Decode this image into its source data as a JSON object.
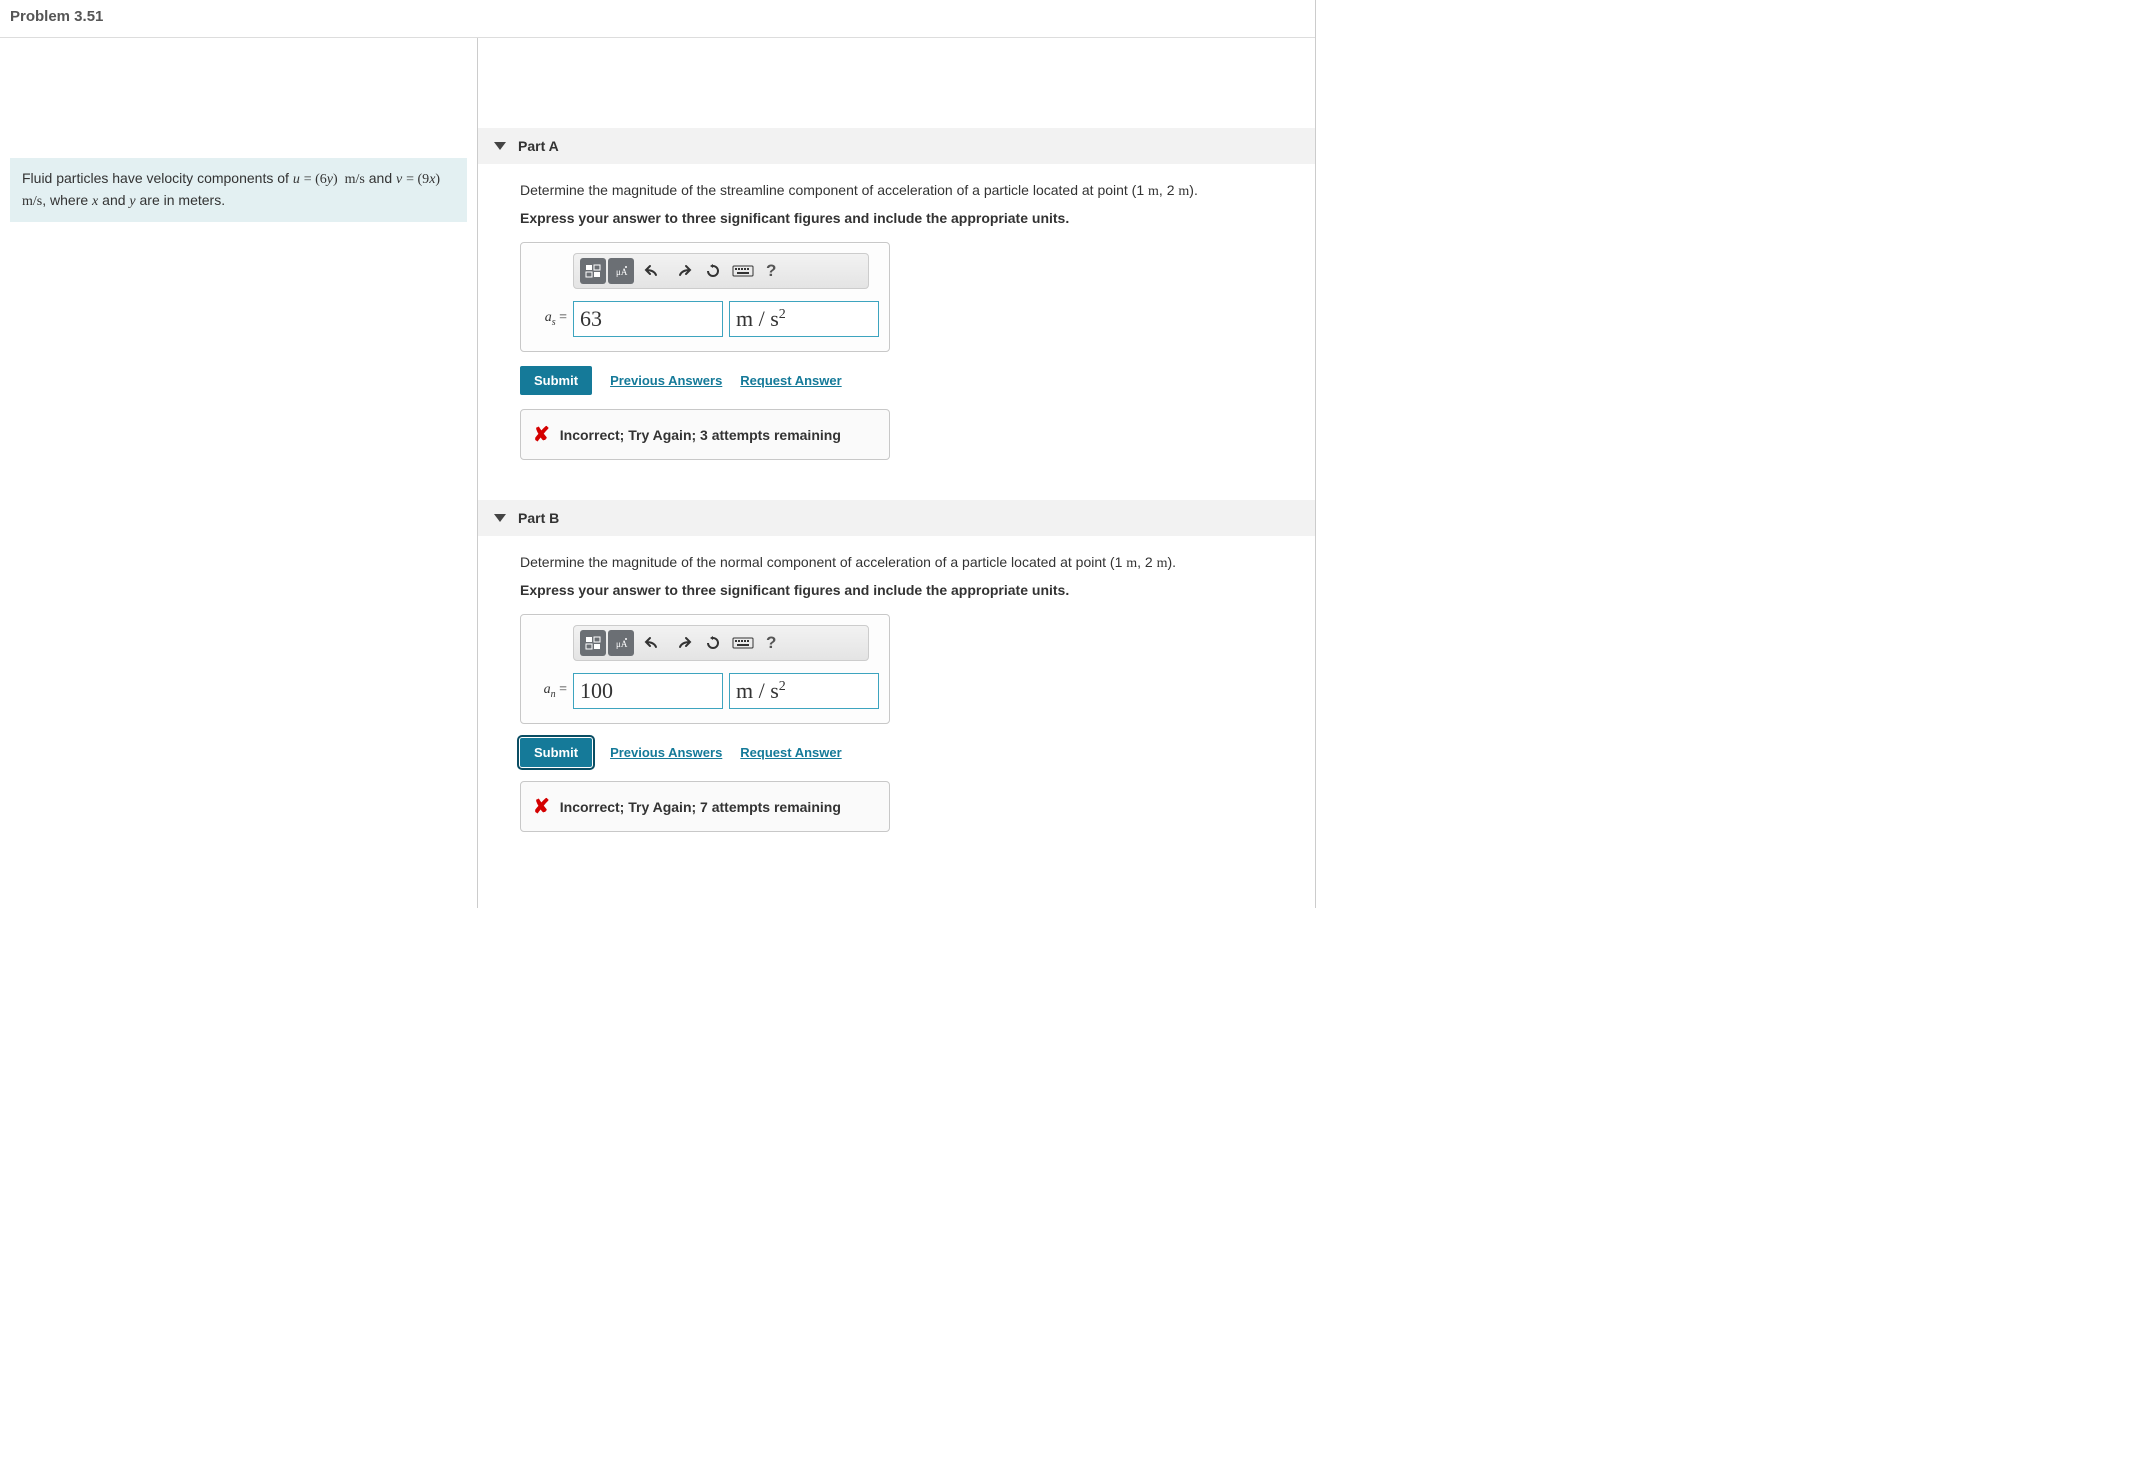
{
  "header": {
    "title": "Problem 3.51"
  },
  "problem_statement": {
    "prefix": "Fluid particles have velocity components of ",
    "u_eq": "u = (6y)  m/s",
    "mid": " and ",
    "v_eq": "v = (9x)  m/s",
    "suffix": ", where ",
    "x_var": "x",
    "and_txt": " and ",
    "y_var": "y",
    "tail": " are in meters."
  },
  "parts": {
    "a": {
      "label": "Part A",
      "instruction_pre": "Determine the magnitude of the streamline component of acceleration of a particle located at point (1 ",
      "instruction_unit1": "m",
      "instruction_mid": ", 2 ",
      "instruction_unit2": "m",
      "instruction_post": ").",
      "express": "Express your answer to three significant figures and include the appropriate units.",
      "var_symbol": "a",
      "var_sub": "s",
      "equals": " = ",
      "value": "63",
      "unit_display": "m / s²",
      "submit": "Submit",
      "prev": "Previous Answers",
      "req": "Request Answer",
      "feedback": "Incorrect; Try Again; 3 attempts remaining",
      "help": "?"
    },
    "b": {
      "label": "Part B",
      "instruction_pre": "Determine the magnitude of the normal component of acceleration of a particle located at point (1 ",
      "instruction_unit1": "m",
      "instruction_mid": ", 2 ",
      "instruction_unit2": "m",
      "instruction_post": ").",
      "express": "Express your answer to three significant figures and include the appropriate units.",
      "var_symbol": "a",
      "var_sub": "n",
      "equals": " = ",
      "value": "100",
      "unit_display": "m / s²",
      "submit": "Submit",
      "prev": "Previous Answers",
      "req": "Request Answer",
      "feedback": "Incorrect; Try Again; 7 attempts remaining",
      "help": "?"
    }
  },
  "toolbar": {
    "templates": "templates-icon",
    "symbols": "symbols-icon",
    "undo": "undo-icon",
    "redo": "redo-icon",
    "reset": "reset-icon",
    "keyboard": "keyboard-icon"
  }
}
